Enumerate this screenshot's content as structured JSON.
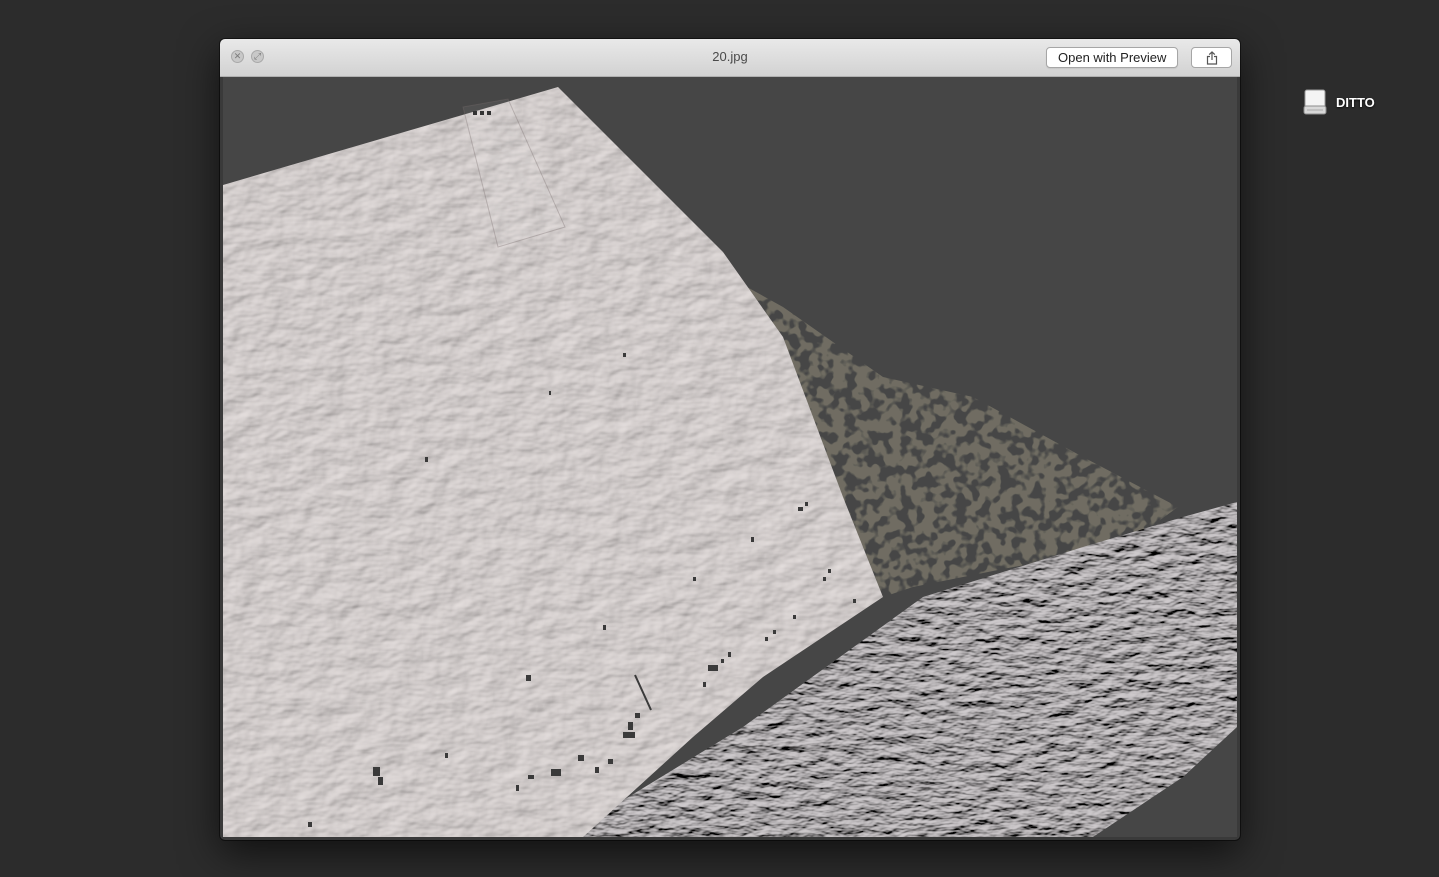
{
  "window": {
    "title": "20.jpg",
    "open_button_label": "Open with Preview"
  },
  "icons": {
    "close": "close-icon",
    "fullscreen": "fullscreen-icon",
    "share": "share-icon",
    "drive": "external-drive-icon"
  },
  "desktop": {
    "drive_label": "DITTO"
  },
  "colors": {
    "desktop_bg": "#2c2c2c",
    "viewer_bg": "#464646",
    "surface": "#d8d2d0"
  }
}
